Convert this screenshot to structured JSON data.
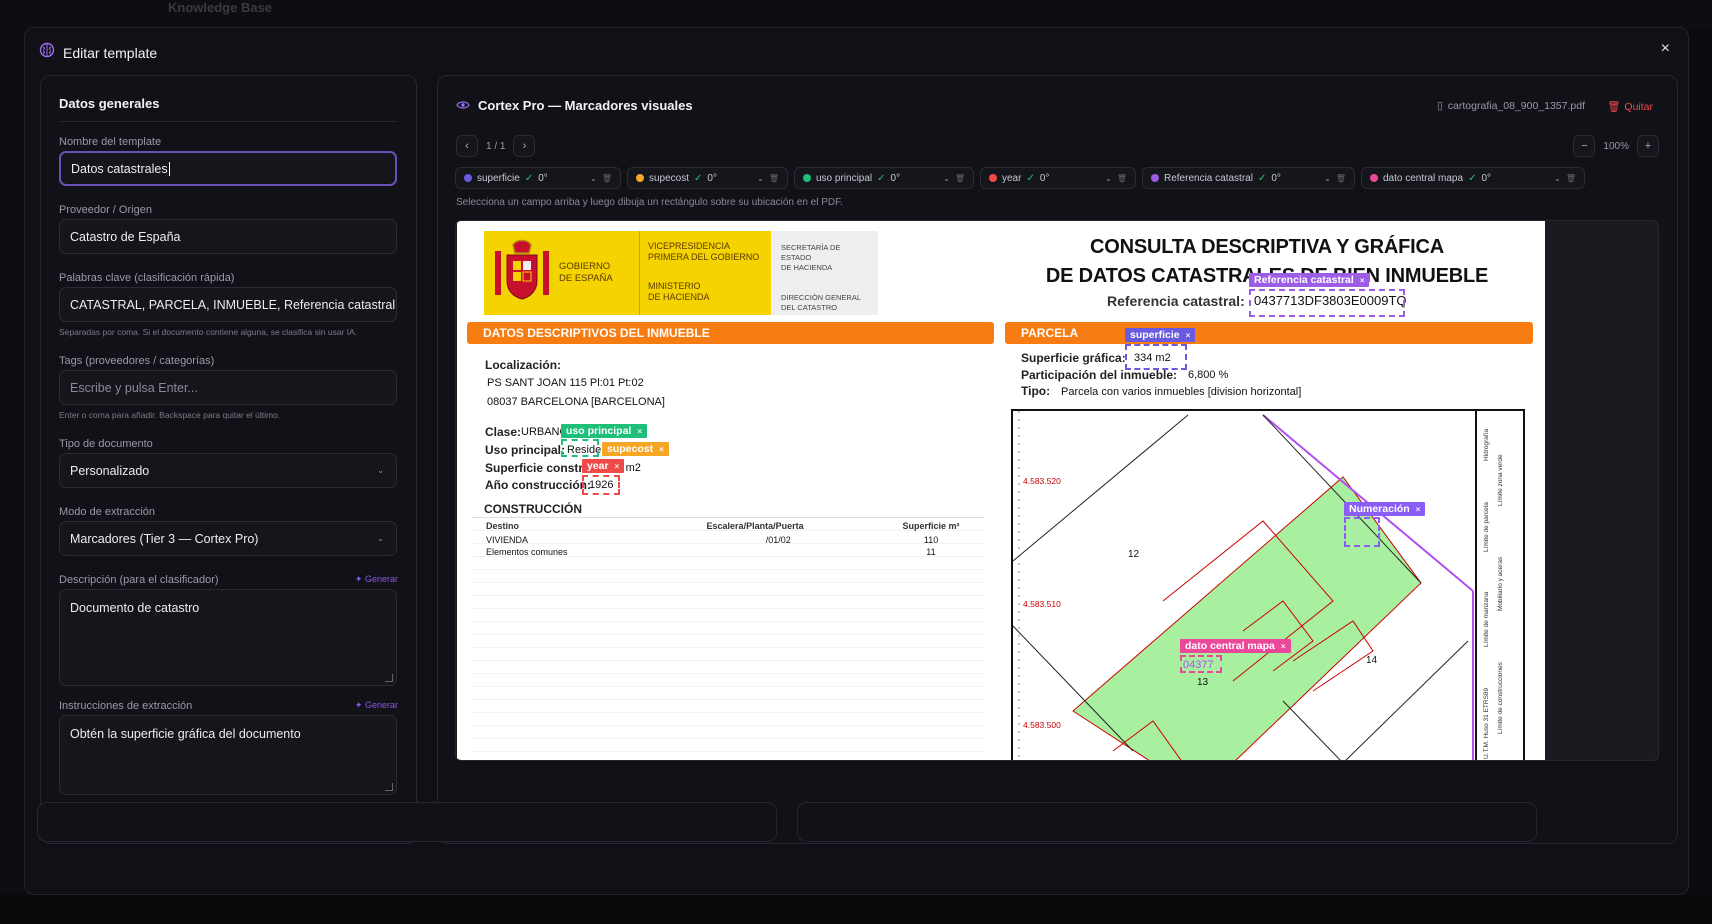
{
  "background": {
    "app_title": "Knowledge Base"
  },
  "modal": {
    "title": "Editar template",
    "close_label": "×"
  },
  "left": {
    "section_title": "Datos generales",
    "name": {
      "label": "Nombre del template",
      "value": "Datos catastrales"
    },
    "provider": {
      "label": "Proveedor / Origen",
      "value": "Catastro de España"
    },
    "keywords": {
      "label": "Palabras clave (clasificación rápida)",
      "value": "CATASTRAL, PARCELA, INMUEBLE, Referencia catastral",
      "help": "Separadas por coma. Si el documento contiene alguna, se clasifica sin usar IA."
    },
    "tags": {
      "label": "Tags (proveedores / categorías)",
      "placeholder": "Escribe y pulsa Enter...",
      "help": "Enter o coma para añadir. Backspace para quitar el último."
    },
    "doc_type": {
      "label": "Tipo de documento",
      "value": "Personalizado"
    },
    "extract_mode": {
      "label": "Modo de extracción",
      "value": "Marcadores (Tier 3 — Cortex Pro)"
    },
    "description": {
      "label": "Descripción (para el clasificador)",
      "generate": "Generar",
      "value": "Documento de catastro"
    },
    "instructions": {
      "label": "Instrucciones de extracción",
      "generate": "Generar",
      "value": "Obtén la superficie gráfica del documento"
    }
  },
  "right": {
    "title": "Cortex Pro — Marcadores visuales",
    "file_name": "cartografia_08_900_1357.pdf",
    "remove_label": "Quitar",
    "page_indicator": "1 / 1",
    "zoom": "100%",
    "hint": "Selecciona un campo arriba y luego dibuja un rectángulo sobre su ubicación en el PDF.",
    "fields": [
      {
        "name": "superficie",
        "check": "✓",
        "rot": "0°",
        "color": "#6a5ae0"
      },
      {
        "name": "supecost",
        "check": "✓",
        "rot": "0°",
        "color": "#f5a623"
      },
      {
        "name": "uso principal",
        "check": "✓",
        "rot": "0°",
        "color": "#1fbf7a"
      },
      {
        "name": "year",
        "check": "✓",
        "rot": "0°",
        "color": "#ef4a4a"
      },
      {
        "name": "Referencia catastral",
        "check": "✓",
        "rot": "0°",
        "color": "#9b5de5"
      },
      {
        "name": "dato central mapa",
        "check": "✓",
        "rot": "0°",
        "color": "#ec4899"
      }
    ]
  },
  "pdf": {
    "gov_spain": "GOBIERNO\nDE ESPAÑA",
    "vice": "VICEPRESIDENCIA\nPRIMERA DEL GOBIERNO",
    "ministry": "MINISTERIO\nDE HACIENDA",
    "secretaria": "SECRETARÍA DE ESTADO\nDE HACIENDA",
    "direccion": "DIRECCIÓN GENERAL\nDEL CATASTRO",
    "title_line1": "CONSULTA DESCRIPTIVA Y GRÁFICA",
    "title_line2": "DE DATOS CATASTRALES DE BIEN INMUEBLE",
    "ref_label": "Referencia catastral:",
    "ref_value": "0437713DF3803E0009TQ",
    "desc_bar": "DATOS DESCRIPTIVOS DEL INMUEBLE",
    "parcela_bar": "PARCELA",
    "loc_label": "Localización:",
    "loc_line1": "PS SANT JOAN 115 Pl:01 Pt:02",
    "loc_line2": "08037 BARCELONA [BARCELONA]",
    "clase_label": "Clase:",
    "clase_value": "URBANO",
    "uso_label": "Uso principal:",
    "uso_value": "Residencial",
    "sup_label": "Superficie construida:",
    "sup_value": "110 m2",
    "anio_label": "Año construcción:",
    "anio_value": "1926",
    "construccion": "CONSTRUCCIÓN",
    "table_headers": [
      "Destino",
      "Escalera/Planta/Puerta",
      "Superficie m²"
    ],
    "table_rows": [
      [
        "VIVIENDA",
        "/01/02",
        "110"
      ],
      [
        "Elementos comunes",
        "",
        "11"
      ]
    ],
    "sup_graf_label": "Superficie gráfica:",
    "sup_graf_value": "334 m2",
    "part_label": "Participación del inmueble:",
    "part_value": "6,800 %",
    "tipo_label": "Tipo:",
    "tipo_value": "Parcela con varios inmuebles [division horizontal]",
    "map_labels": {
      "y1": "4.583.520",
      "y2": "4.583.510",
      "y3": "4.583.500",
      "p12": "12",
      "p13": "13",
      "p14": "14",
      "num": "04377"
    },
    "legend": [
      "Hidrografía",
      "Límite zona verde",
      "Límite de parcela",
      "Mobiliario y aceras",
      "Límite de manzana",
      "Límite de construcciones",
      "U.T.M. Huso 31 ETRS89"
    ]
  },
  "markers": [
    {
      "label": "Referencia catastral",
      "x": "×",
      "color": "#9b5de5"
    },
    {
      "label": "superficie",
      "x": "×",
      "color": "#6a5ae0"
    },
    {
      "label": "uso principal",
      "x": "×",
      "color": "#1fbf7a"
    },
    {
      "label": "supecost",
      "x": "×",
      "color": "#f5a623"
    },
    {
      "label": "year",
      "x": "×",
      "color": "#ef4a4a"
    },
    {
      "label": "Numeración",
      "x": "×",
      "color": "#8b5cf6"
    },
    {
      "label": "dato central mapa",
      "x": "×",
      "color": "#ec4899"
    }
  ]
}
